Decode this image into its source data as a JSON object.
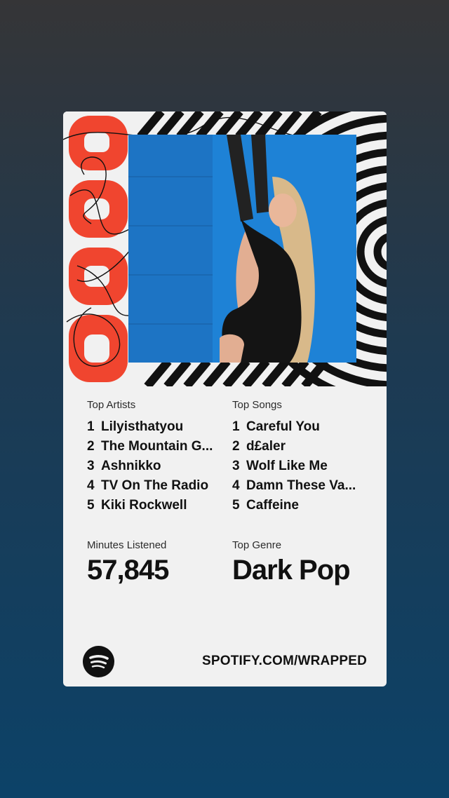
{
  "card": {
    "year_art_text": "2025",
    "top_artists": {
      "heading": "Top Artists",
      "items": [
        {
          "rank": "1",
          "name": "Lilyisthatyou"
        },
        {
          "rank": "2",
          "name": "The Mountain G..."
        },
        {
          "rank": "3",
          "name": "Ashnikko"
        },
        {
          "rank": "4",
          "name": "TV On The Radio"
        },
        {
          "rank": "5",
          "name": "Kiki Rockwell"
        }
      ]
    },
    "top_songs": {
      "heading": "Top Songs",
      "items": [
        {
          "rank": "1",
          "name": "Careful You"
        },
        {
          "rank": "2",
          "name": "d£aler"
        },
        {
          "rank": "3",
          "name": "Wolf Like Me"
        },
        {
          "rank": "4",
          "name": "Damn These Va..."
        },
        {
          "rank": "5",
          "name": "Caffeine"
        }
      ]
    },
    "minutes": {
      "label": "Minutes Listened",
      "value": "57,845"
    },
    "genre": {
      "label": "Top Genre",
      "value": "Dark Pop"
    },
    "footer": {
      "url": "SPOTIFY.COM/WRAPPED",
      "logo_icon": "spotify-logo-icon"
    }
  },
  "colors": {
    "card_bg": "#f1f1f1",
    "accent_red": "#f0452f",
    "photo_bg": "#1e82d6",
    "text": "#111111"
  }
}
